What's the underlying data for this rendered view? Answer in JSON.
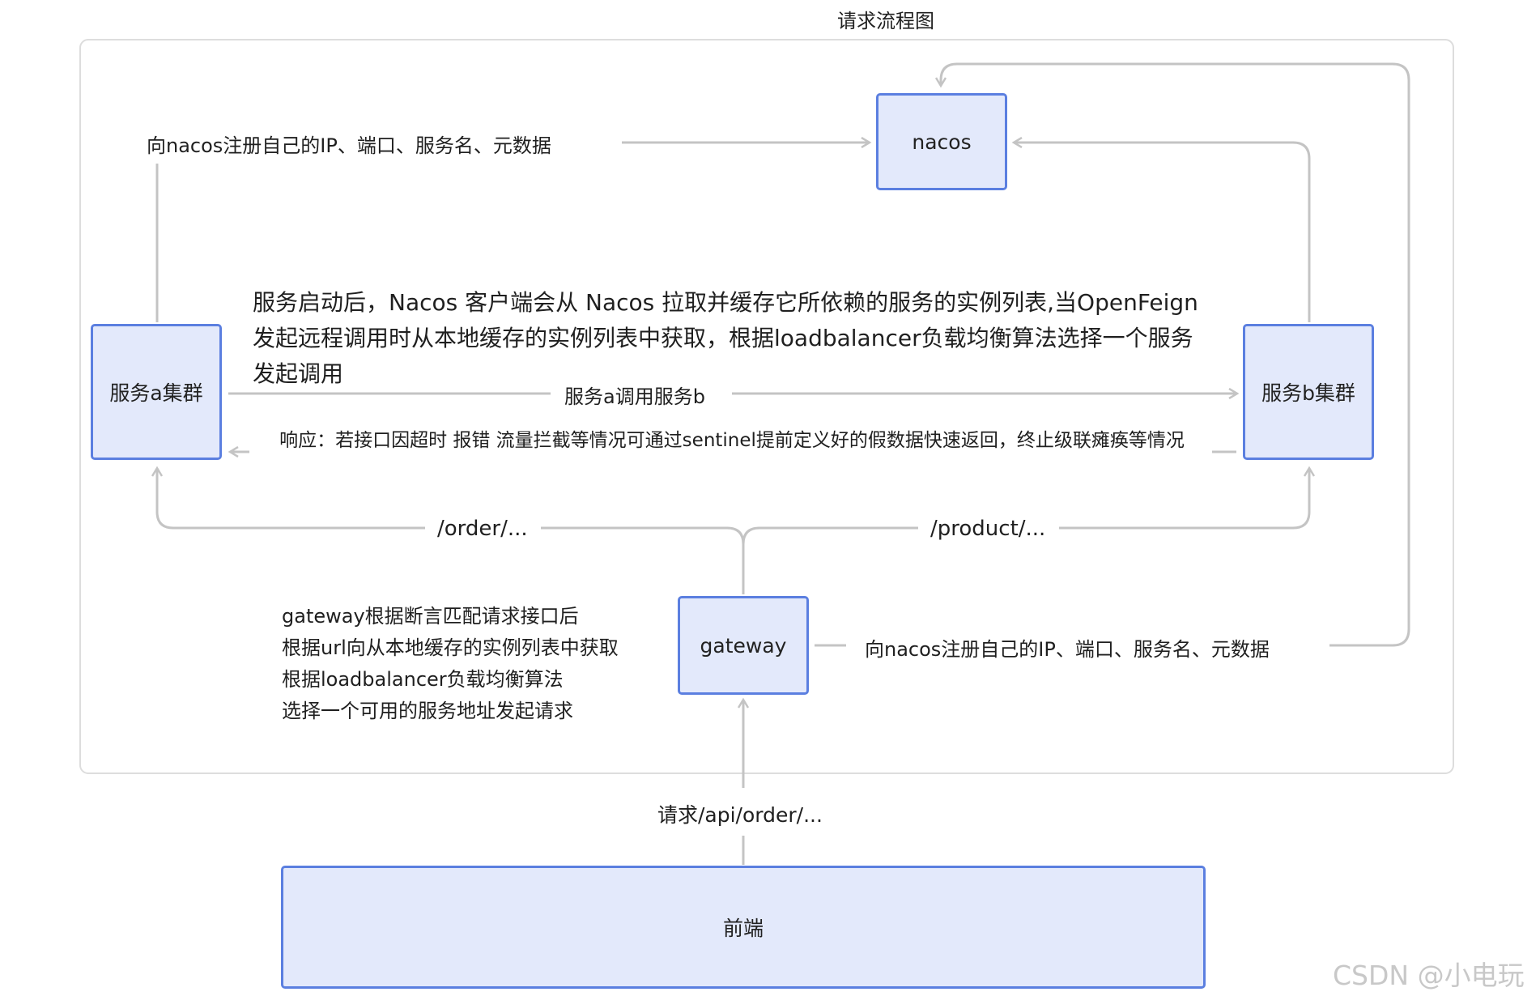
{
  "title": "请求流程图",
  "nodes": {
    "nacos": "nacos",
    "service_a": "服务a集群",
    "service_b": "服务b集群",
    "gateway": "gateway",
    "frontend": "前端"
  },
  "labels": {
    "register_a": "向nacos注册自己的IP、端口、服务名、元数据",
    "register_gw": "向nacos注册自己的IP、端口、服务名、元数据",
    "startup_note": "服务启动后，Nacos 客户端会从 Nacos  拉取并缓存它所依赖的服务的实例列表,当OpenFeign 发起远程调用时从本地缓存的实例列表中获取，根据loadbalancer负载均衡算法选择一个服务发起调用",
    "call_ab": "服务a调用服务b",
    "response": "响应：若接口因超时 报错 流量拦截等情况可通过sentinel提前定义好的假数据快速返回，终止级联瘫痪等情况",
    "order_path": "/order/...",
    "product_path": "/product/...",
    "gw_note_1": "gateway根据断言匹配请求接口后",
    "gw_note_2": "根据url向从本地缓存的实例列表中获取",
    "gw_note_3": "根据loadbalancer负载均衡算法",
    "gw_note_4": "选择一个可用的服务地址发起请求",
    "request_path": "请求/api/order/..."
  },
  "watermark": "CSDN @小电玩",
  "colors": {
    "node_border": "#5b7fe0",
    "node_fill": "#e3e9fb",
    "line": "#c4c4c4"
  }
}
